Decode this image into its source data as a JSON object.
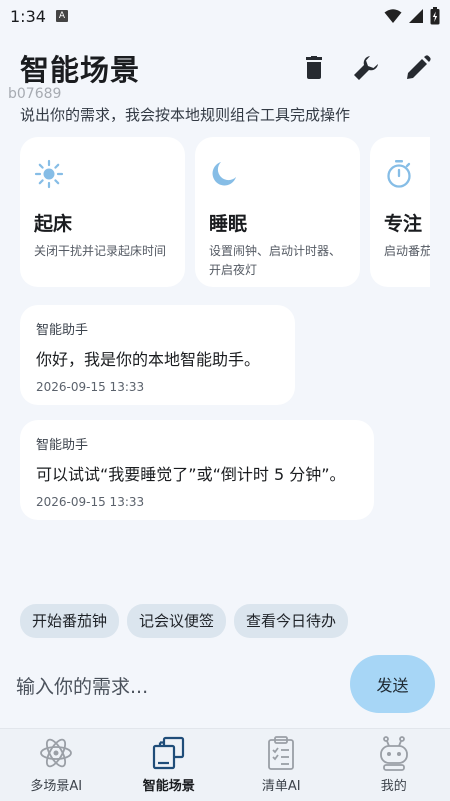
{
  "status_bar": {
    "time": "1:34",
    "notification_badge": "A"
  },
  "header": {
    "title": "智能场景",
    "actions": [
      "delete-icon",
      "wrench-icon",
      "edit-icon"
    ]
  },
  "watermark": "b07689",
  "subtitle": "说出你的需求，我会按本地规则组合工具完成操作",
  "scenes": [
    {
      "icon": "sun-icon",
      "title": "起床",
      "desc": "关闭干扰并记录起床时间"
    },
    {
      "icon": "moon-icon",
      "title": "睡眠",
      "desc": "设置闹钟、启动计时器、开启夜灯"
    },
    {
      "icon": "timer-icon",
      "title": "专注",
      "desc": "启动番茄计完成"
    }
  ],
  "messages": [
    {
      "sender": "智能助手",
      "text": "你好，我是你的本地智能助手。",
      "time": "2026-09-15 13:33"
    },
    {
      "sender": "智能助手",
      "text": "可以试试“我要睡觉了”或“倒计时 5 分钟”。",
      "time": "2026-09-15 13:33"
    }
  ],
  "chips": [
    "开始番茄钟",
    "记会议便签",
    "查看今日待办"
  ],
  "composer": {
    "placeholder": "输入你的需求...",
    "send_label": "发送"
  },
  "nav": [
    {
      "icon": "atom-icon",
      "label": "多场景AI",
      "active": false
    },
    {
      "icon": "layers-icon",
      "label": "智能场景",
      "active": true
    },
    {
      "icon": "clipboard-icon",
      "label": "清单AI",
      "active": false
    },
    {
      "icon": "robot-icon",
      "label": "我的",
      "active": false
    }
  ],
  "colors": {
    "accent": "#a7d6f6",
    "background": "#f3f6fb",
    "chip": "#dbe5ee",
    "icon_blue": "#86bde6"
  }
}
